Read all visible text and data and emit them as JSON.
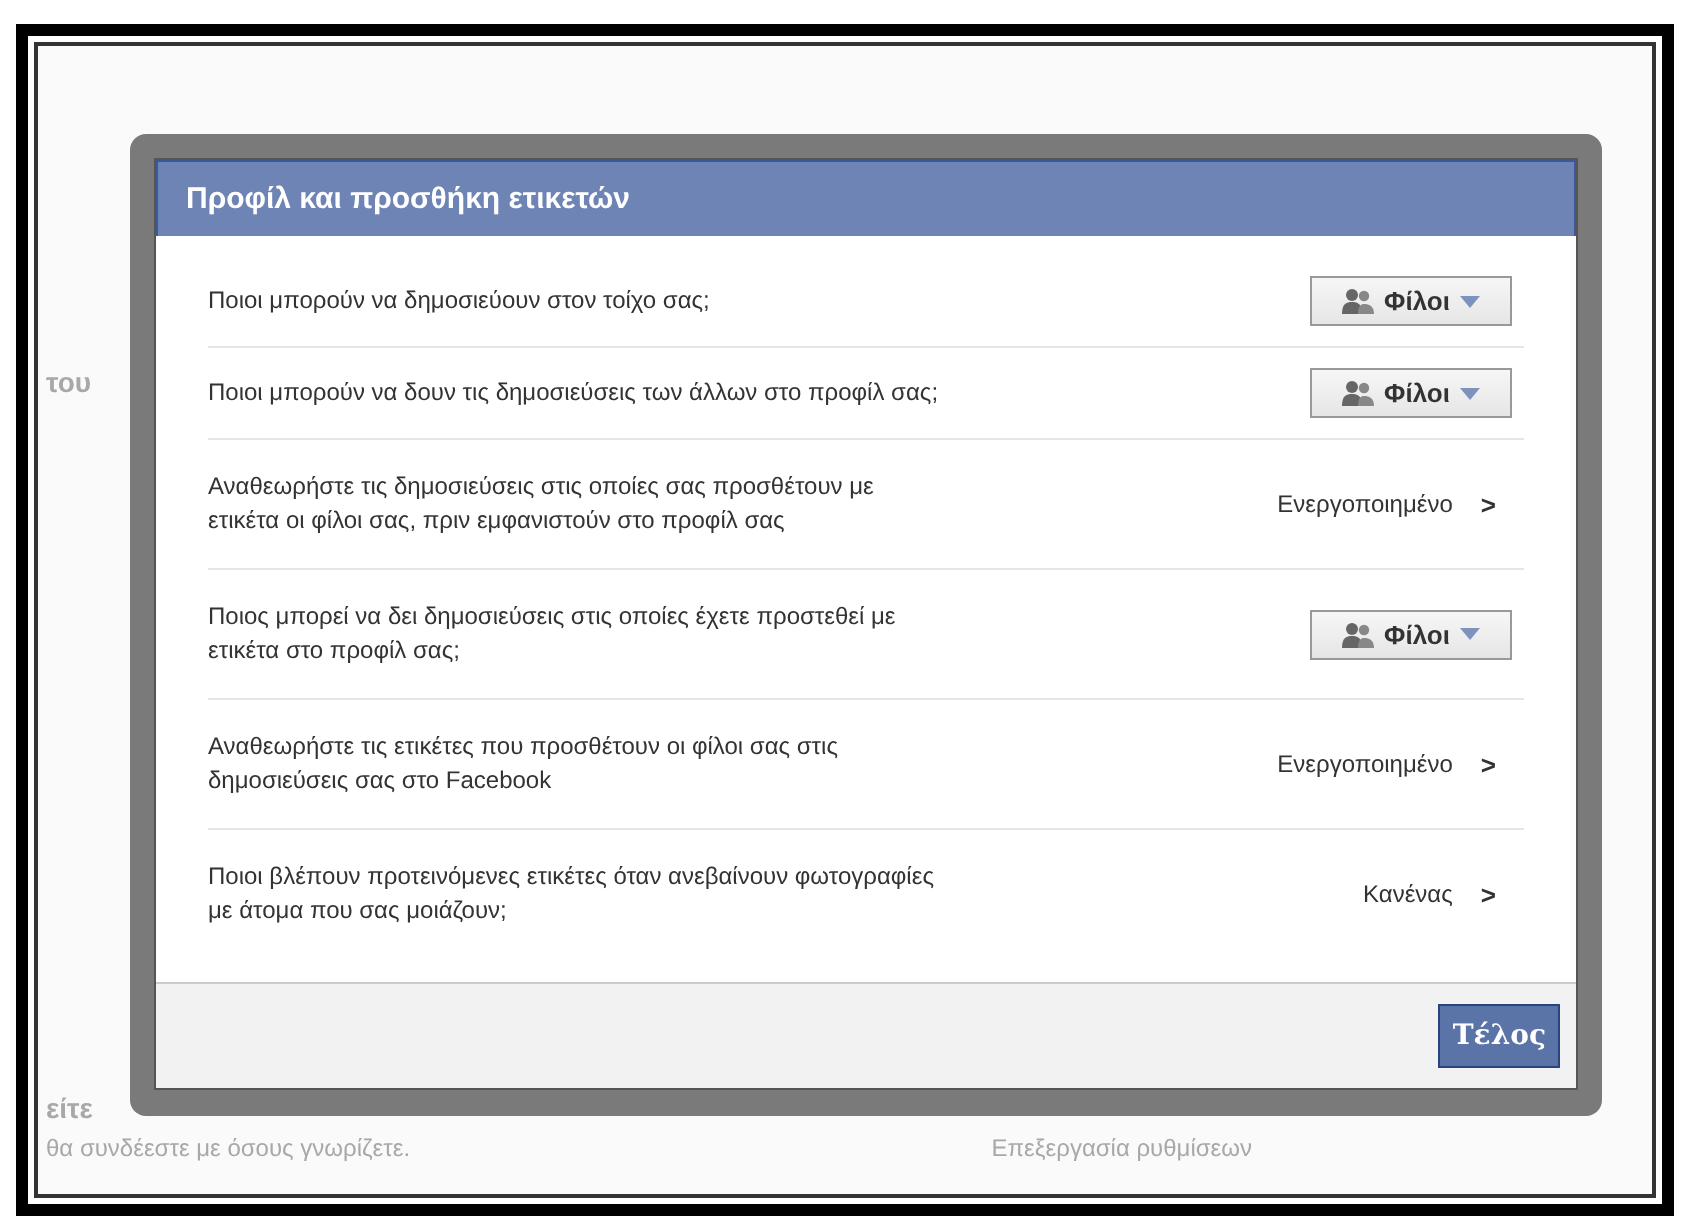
{
  "background": {
    "heading_fragment": "του",
    "bottom_heading_fragment": "είτε",
    "bottom_note": "θα συνδέεστε με όσους γνωρίζετε.",
    "bottom_link": "Επεξεργασία ρυθμίσεων"
  },
  "dialog": {
    "title": "Προφίλ και προσθήκη ετικετών",
    "settings": [
      {
        "kind": "dropdown",
        "label": "Ποιοι μπορούν να δημοσιεύουν στον τοίχο σας;",
        "value": "Φίλοι"
      },
      {
        "kind": "dropdown",
        "label": "Ποιοι μπορούν να δουν τις δημοσιεύσεις των άλλων στο προφίλ σας;",
        "value": "Φίλοι"
      },
      {
        "kind": "link",
        "label": "Αναθεωρήστε τις δημοσιεύσεις στις οποίες σας προσθέτουν με ετικέτα οι φίλοι σας, πριν εμφανιστούν στο προφίλ σας",
        "value": "Ενεργοποιημένο",
        "arrow": ">"
      },
      {
        "kind": "dropdown",
        "label": "Ποιος μπορεί να δει δημοσιεύσεις στις οποίες έχετε προστεθεί με ετικέτα στο προφίλ σας;",
        "value": "Φίλοι"
      },
      {
        "kind": "link",
        "label": "Αναθεωρήστε τις ετικέτες που προσθέτουν οι φίλοι σας στις δημοσιεύσεις σας στο Facebook",
        "value": "Ενεργοποιημένο",
        "arrow": ">"
      },
      {
        "kind": "link",
        "label": "Ποιοι βλέπουν προτεινόμενες ετικέτες όταν ανεβαίνουν φωτογραφίες με άτομα που σας μοιάζουν;",
        "value": "Κανένας",
        "arrow": ">"
      }
    ],
    "done_button": "Τέλος"
  }
}
